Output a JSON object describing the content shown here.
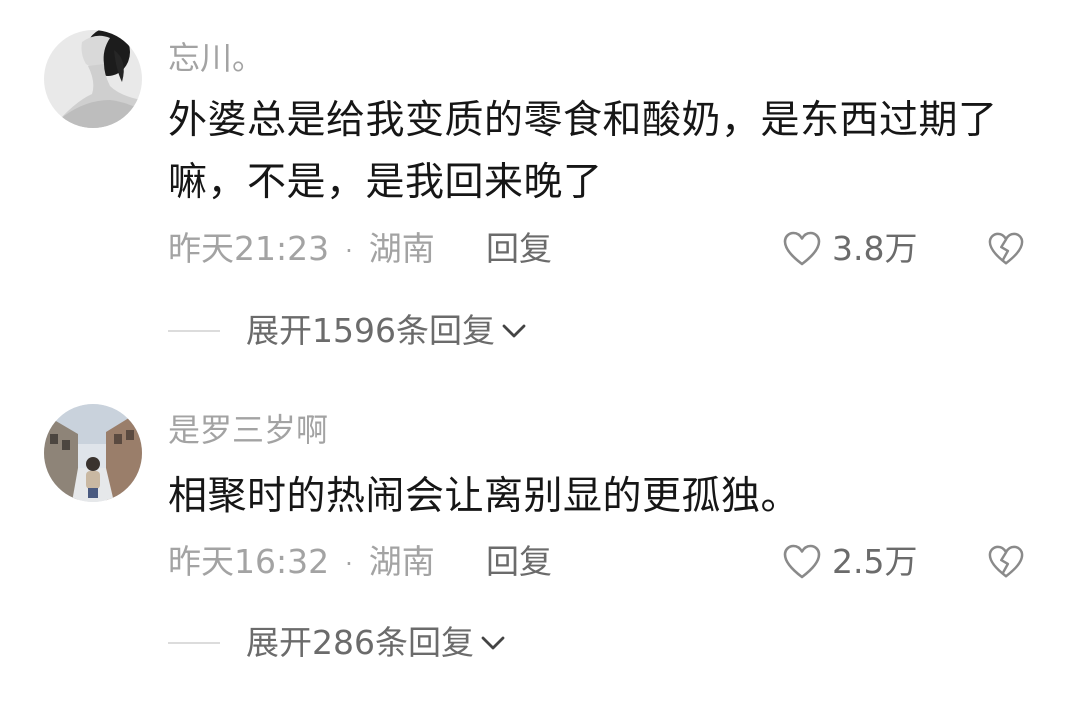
{
  "comments": [
    {
      "username": "忘川。",
      "text": "外婆总是给我变质的零食和酸奶，是东西过期了嘛，不是，是我回来晚了",
      "time": "昨天21:23",
      "separator": "·",
      "location": "湖南",
      "reply_label": "回复",
      "likes": "3.8万",
      "expand_label": "展开1596条回复",
      "avatar_icon": "woman-portrait-avatar"
    },
    {
      "username": "是罗三岁啊",
      "text": "相聚时的热闹会让离别显的更孤独。",
      "time": "昨天16:32",
      "separator": "·",
      "location": "湖南",
      "reply_label": "回复",
      "likes": "2.5万",
      "expand_label": "展开286条回复",
      "avatar_icon": "street-photo-avatar"
    }
  ],
  "icons": {
    "like": "heart-outline-icon",
    "dislike": "broken-heart-icon",
    "expand": "chevron-down-icon"
  },
  "colors": {
    "text": "#161616",
    "muted": "#a3a3a3",
    "secondary": "#6b6b6b",
    "divider": "#dcdcdc"
  }
}
